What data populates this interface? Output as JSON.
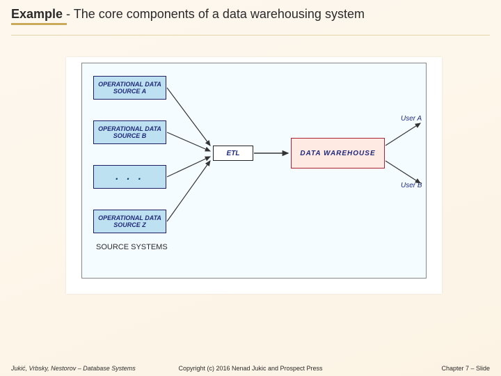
{
  "title": {
    "strong": "Example",
    "rest": " - The core components of a data warehousing system"
  },
  "diagram": {
    "sources": {
      "a": "OPERATIONAL DATA SOURCE A",
      "b": "OPERATIONAL DATA SOURCE B",
      "ellipsis": ". . .",
      "z": "OPERATIONAL DATA SOURCE Z",
      "label": "SOURCE SYSTEMS"
    },
    "etl": "ETL",
    "warehouse": "DATA  WAREHOUSE",
    "users": {
      "a": "User A",
      "b": "User B"
    }
  },
  "footer": {
    "left": "Jukić, Vrbsky, Nestorov – Database Systems",
    "mid": "Copyright (c) 2016 Nenad Jukic and Prospect Press",
    "right": "Chapter 7 – Slide"
  }
}
